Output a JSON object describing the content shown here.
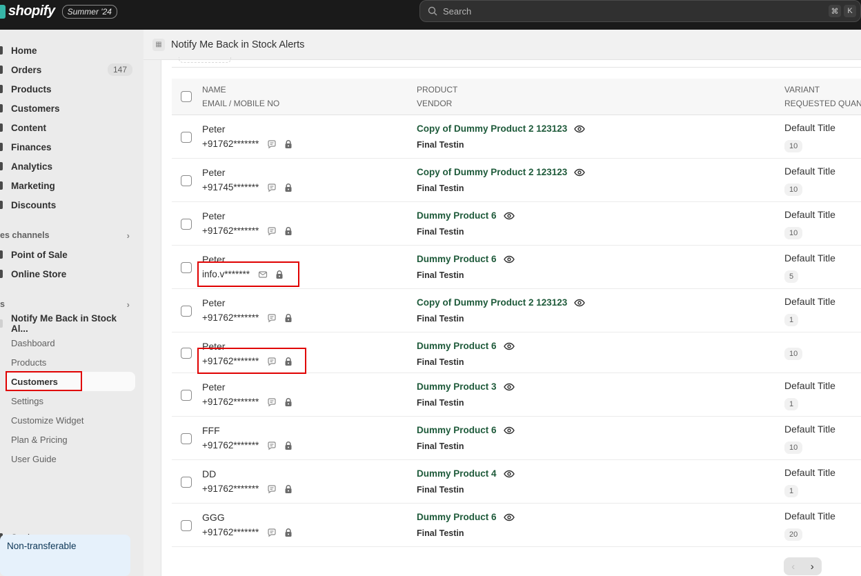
{
  "topbar": {
    "brand": "shopify",
    "edition": "Summer '24",
    "search_placeholder": "Search",
    "shortcut_keys": [
      "⌘",
      "K"
    ]
  },
  "sidebar": {
    "main_items": [
      {
        "label": "Home",
        "icon": "home-icon"
      },
      {
        "label": "Orders",
        "icon": "orders-icon",
        "badge": "147"
      },
      {
        "label": "Products",
        "icon": "tag-icon"
      },
      {
        "label": "Customers",
        "icon": "person-icon"
      },
      {
        "label": "Content",
        "icon": "content-icon"
      },
      {
        "label": "Finances",
        "icon": "bank-icon"
      },
      {
        "label": "Analytics",
        "icon": "chart-icon"
      },
      {
        "label": "Marketing",
        "icon": "target-icon"
      },
      {
        "label": "Discounts",
        "icon": "discount-icon"
      }
    ],
    "sales_channels_label": "es channels",
    "sales_channels": [
      {
        "label": "Point of Sale",
        "icon": "pos-icon"
      },
      {
        "label": "Online Store",
        "icon": "store-icon"
      }
    ],
    "apps_label": "s",
    "app_name": "Notify Me Back in Stock Al...",
    "app_subitems": [
      "Dashboard",
      "Products",
      "Customers",
      "Settings",
      "Customize Widget",
      "Plan & Pricing",
      "User Guide"
    ],
    "active_subitem": "Customers",
    "settings_label": "Settings",
    "callout_text": "Non-transferable"
  },
  "header": {
    "title": "Notify Me Back in Stock Alerts"
  },
  "table": {
    "headers": {
      "col1_top": "NAME",
      "col1_bottom": "EMAIL / MOBILE NO",
      "col2_top": "PRODUCT",
      "col2_bottom": "VENDOR",
      "col3_top": "VARIANT",
      "col3_bottom": "REQUESTED QUAN"
    },
    "rows": [
      {
        "name": "Peter",
        "contact": "+91762*******",
        "contact_type": "sms",
        "product": "Copy of Dummy Product 2 123123",
        "vendor": "Final Testin",
        "variant": "Default Title",
        "qty": "10"
      },
      {
        "name": "Peter",
        "contact": "+91745*******",
        "contact_type": "sms",
        "product": "Copy of Dummy Product 2 123123",
        "vendor": "Final Testin",
        "variant": "Default Title",
        "qty": "10"
      },
      {
        "name": "Peter",
        "contact": "+91762*******",
        "contact_type": "sms",
        "product": "Dummy Product 6",
        "vendor": "Final Testin",
        "variant": "Default Title",
        "qty": "10"
      },
      {
        "name": "Peter",
        "contact": "info.v*******",
        "contact_type": "email",
        "product": "Dummy Product 6",
        "vendor": "Final Testin",
        "variant": "Default Title",
        "qty": "5"
      },
      {
        "name": "Peter",
        "contact": "+91762*******",
        "contact_type": "sms",
        "product": "Copy of Dummy Product 2 123123",
        "vendor": "Final Testin",
        "variant": "Default Title",
        "qty": "1"
      },
      {
        "name": "Peter",
        "contact": "+91762*******",
        "contact_type": "sms",
        "product": "Dummy Product 6",
        "vendor": "Final Testin",
        "variant": "",
        "qty": "10"
      },
      {
        "name": "Peter",
        "contact": "+91762*******",
        "contact_type": "sms",
        "product": "Dummy Product 3",
        "vendor": "Final Testin",
        "variant": "Default Title",
        "qty": "1"
      },
      {
        "name": "FFF",
        "contact": "+91762*******",
        "contact_type": "sms",
        "product": "Dummy Product 6",
        "vendor": "Final Testin",
        "variant": "Default Title",
        "qty": "10"
      },
      {
        "name": "DD",
        "contact": "+91762*******",
        "contact_type": "sms",
        "product": "Dummy Product 4",
        "vendor": "Final Testin",
        "variant": "Default Title",
        "qty": "1"
      },
      {
        "name": "GGG",
        "contact": "+91762*******",
        "contact_type": "sms",
        "product": "Dummy Product 6",
        "vendor": "Final Testin",
        "variant": "Default Title",
        "qty": "20"
      }
    ]
  },
  "pagination": {
    "prev": "‹",
    "next": "›"
  },
  "colors": {
    "product_link": "#1e5a3a",
    "highlight": "#e00000",
    "topbar": "#1a1a1a"
  }
}
